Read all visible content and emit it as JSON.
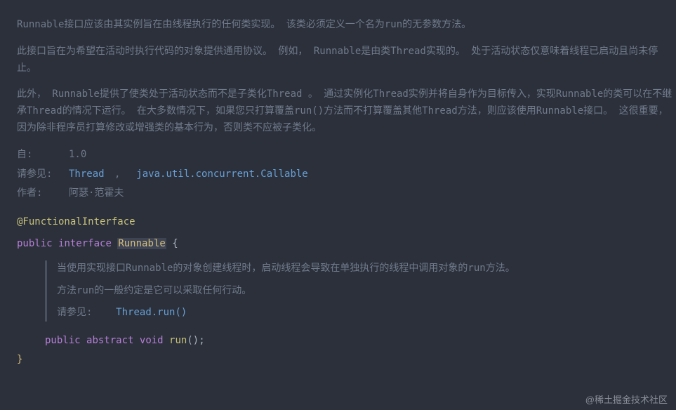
{
  "doc": {
    "para1": "Runnable接口应该由其实例旨在由线程执行的任何类实现。 该类必须定义一个名为run的无参数方法。",
    "para2": "此接口旨在为希望在活动时执行代码的对象提供通用协议。 例如， Runnable是由类Thread实现的。 处于活动状态仅意味着线程已启动且尚未停止。",
    "para3": "此外， Runnable提供了使类处于活动状态而不是子类化Thread 。 通过实例化Thread实例并将自身作为目标传入，实现Runnable的类可以在不继承Thread的情况下运行。 在大多数情况下，如果您只打算覆盖run()方法而不打算覆盖其他Thread方法，则应该使用Runnable接口。 这很重要，因为除非程序员打算修改或增强类的基本行为，否则类不应被子类化。",
    "since_label": "自:",
    "since_value": "1.0",
    "see_label": "请参见:",
    "see_link1": "Thread",
    "see_link2": "java.util.concurrent.Callable",
    "author_label": "作者:",
    "author_value": "阿瑟·范霍夫"
  },
  "code": {
    "annotation": "@FunctionalInterface",
    "kw_public": "public",
    "kw_interface": "interface",
    "type_runnable": "Runnable",
    "open_brace": "{",
    "close_brace": "}",
    "inner": {
      "p1": "当使用实现接口Runnable的对象创建线程时，启动线程会导致在单独执行的线程中调用对象的run方法。",
      "p2": "方法run的一般约定是它可以采取任何行动。",
      "see_label": "请参见:",
      "see_link": "Thread.run()"
    },
    "kw_abstract": "abstract",
    "kw_void": "void",
    "method_name": "run",
    "parens": "()",
    "semi": ";"
  },
  "watermark": "@稀土掘金技术社区"
}
